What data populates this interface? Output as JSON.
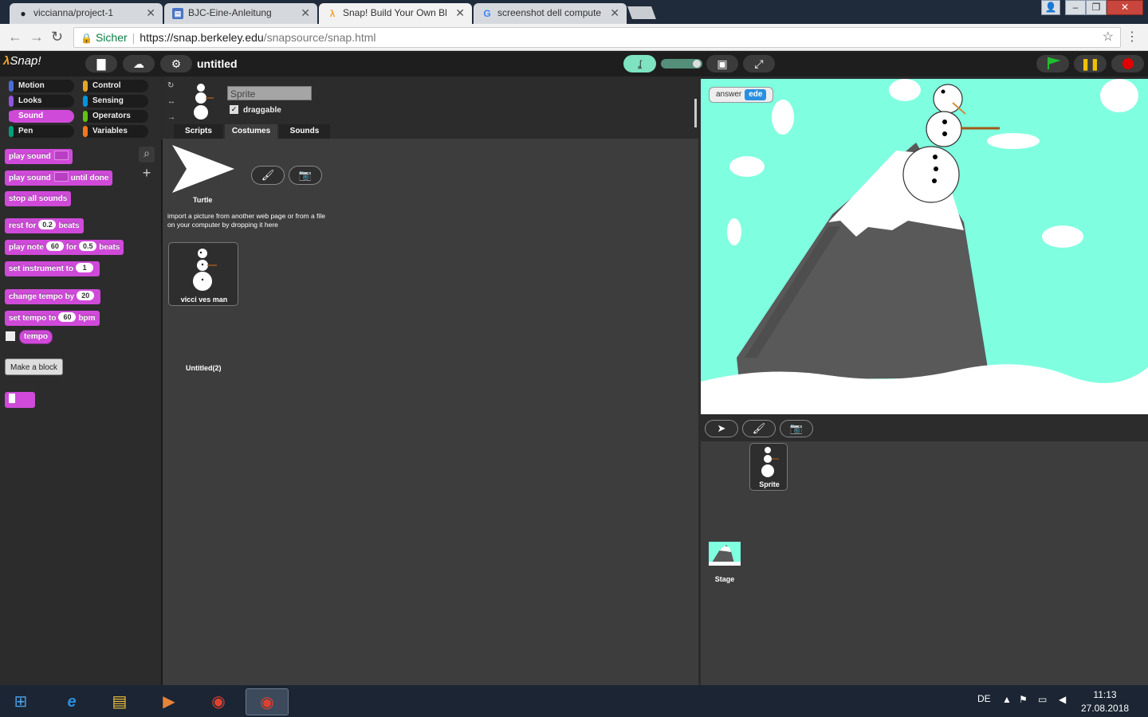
{
  "browser": {
    "tabs": [
      {
        "title": "viccianna/project-1",
        "favicon": "github-icon"
      },
      {
        "title": "BJC-Eine-Anleitung",
        "favicon": "document-icon"
      },
      {
        "title": "Snap! Build Your Own Bl",
        "favicon": "snap-lambda-icon"
      },
      {
        "title": "screenshot dell compute",
        "favicon": "google-icon"
      }
    ],
    "secure_label": "Sicher",
    "url_host": "https://snap.berkeley.edu",
    "url_path": "/snapsource/snap.html"
  },
  "snap": {
    "logo": "Snap!",
    "project_title": "untitled",
    "categories": [
      {
        "label": "Motion",
        "color": "#4a6cd4"
      },
      {
        "label": "Control",
        "color": "#e6a822"
      },
      {
        "label": "Looks",
        "color": "#8f56e3"
      },
      {
        "label": "Sensing",
        "color": "#0494dc"
      },
      {
        "label": "Sound",
        "color": "#cf4ad9"
      },
      {
        "label": "Operators",
        "color": "#62c213"
      },
      {
        "label": "Pen",
        "color": "#00a178"
      },
      {
        "label": "Variables",
        "color": "#f3761d"
      }
    ],
    "active_category": "Sound",
    "blocks": {
      "play_sound": "play sound",
      "play_sound_until": "play sound",
      "until_done": "until done",
      "stop_all": "stop all sounds",
      "rest_for": "rest for",
      "rest_value": "0.2",
      "beats": "beats",
      "play_note": "play note",
      "note_value": "60",
      "for": "for",
      "note_beats": "0.5",
      "set_instrument": "set instrument to",
      "instrument_value": "1",
      "change_tempo": "change tempo by",
      "tempo_change_value": "20",
      "set_tempo": "set tempo to",
      "tempo_value": "60",
      "bpm": "bpm",
      "tempo_reporter": "tempo"
    },
    "make_block": "Make a block",
    "sprite": {
      "name": "Sprite",
      "draggable_label": "draggable",
      "draggable_checked": true
    },
    "tabs": [
      "Scripts",
      "Costumes",
      "Sounds"
    ],
    "active_tab": "Costumes",
    "costumes": {
      "turtle_label": "Turtle",
      "import_hint": "import a picture from another web page or from a file on your computer by dropping it here",
      "costume_name": "vicci ves man",
      "untitled_costume": "Untitled(2)"
    },
    "stage": {
      "answer_label": "answer",
      "answer_value": "ede",
      "background_color": "#7fffe0"
    },
    "corral": {
      "sprite_label": "Sprite",
      "stage_label": "Stage"
    }
  },
  "taskbar": {
    "language": "DE",
    "time": "11:13",
    "date": "27.08.2018"
  }
}
